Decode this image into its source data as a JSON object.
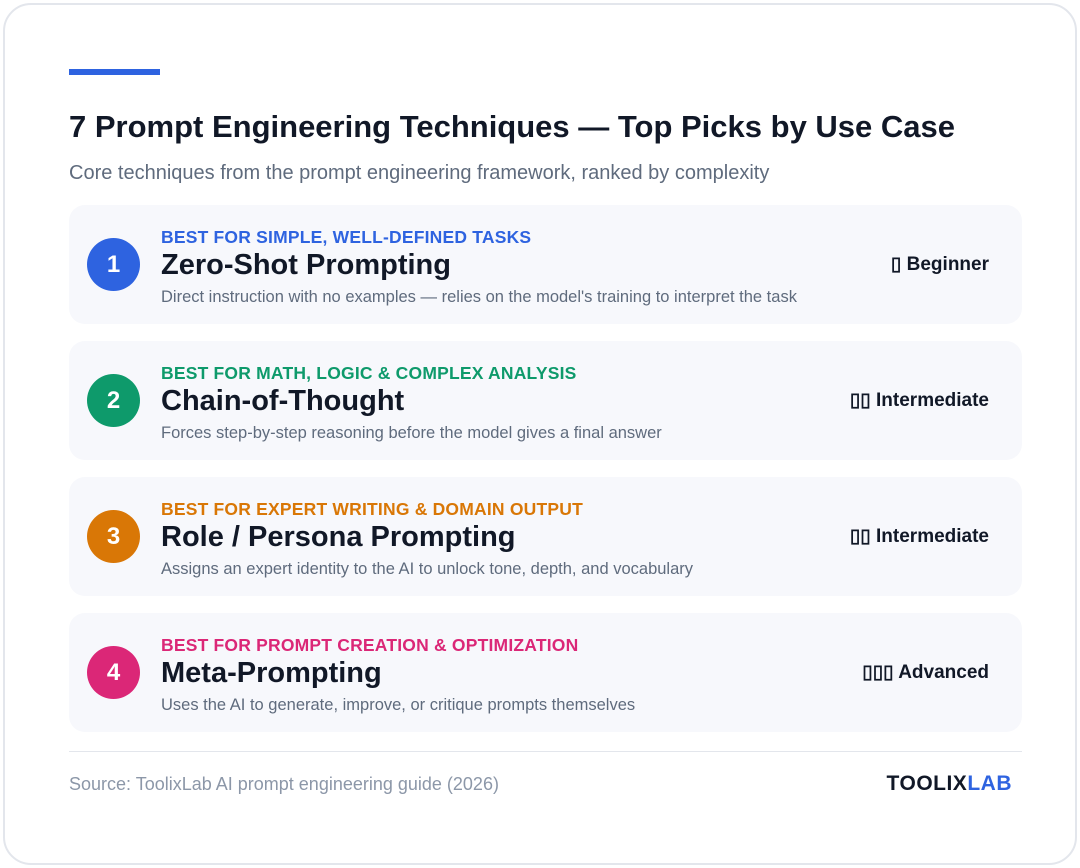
{
  "header": {
    "title": "7 Prompt Engineering Techniques — Top Picks by Use Case",
    "subtitle": "Core techniques from the prompt engineering framework, ranked by complexity"
  },
  "colors": {
    "accent": "#2e63e0",
    "item1": "#2e63e0",
    "item2": "#0e9a6b",
    "item3": "#d97706",
    "item4": "#db2777"
  },
  "items": [
    {
      "number": "1",
      "tag": "BEST FOR SIMPLE, WELL-DEFINED TASKS",
      "name": "Zero-Shot Prompting",
      "description": "Direct instruction with no examples — relies on the model's training to interpret the task",
      "level": "▯ Beginner"
    },
    {
      "number": "2",
      "tag": "BEST FOR MATH, LOGIC & COMPLEX ANALYSIS",
      "name": "Chain-of-Thought",
      "description": "Forces step-by-step reasoning before the model gives a final answer",
      "level": "▯▯ Intermediate"
    },
    {
      "number": "3",
      "tag": "BEST FOR EXPERT WRITING & DOMAIN OUTPUT",
      "name": "Role / Persona Prompting",
      "description": "Assigns an expert identity to the AI to unlock tone, depth, and vocabulary",
      "level": "▯▯ Intermediate"
    },
    {
      "number": "4",
      "tag": "BEST FOR PROMPT CREATION & OPTIMIZATION",
      "name": "Meta-Prompting",
      "description": "Uses the AI to generate, improve, or critique prompts themselves",
      "level": "▯▯▯ Advanced"
    }
  ],
  "footer": {
    "source": "Source: ToolixLab AI prompt engineering guide (2026)",
    "logo_part1": "TOOLIX",
    "logo_part2": "LAB"
  }
}
